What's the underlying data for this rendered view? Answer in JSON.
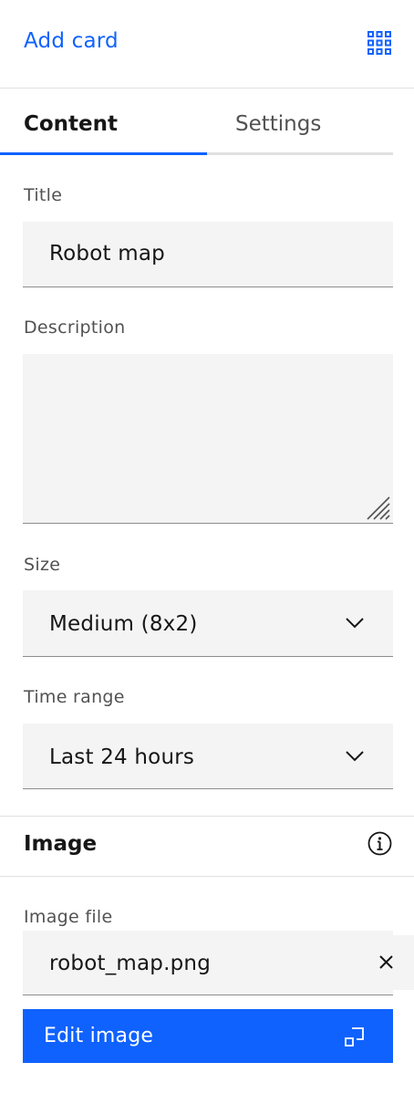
{
  "header": {
    "add_card_label": "Add card",
    "grid_icon": "app-grid-icon"
  },
  "tabs": [
    {
      "label": "Content",
      "selected": true
    },
    {
      "label": "Settings",
      "selected": false
    }
  ],
  "form": {
    "title": {
      "label": "Title",
      "value": "Robot map"
    },
    "description": {
      "label": "Description",
      "value": ""
    },
    "size": {
      "label": "Size",
      "value": "Medium (8x2)"
    },
    "time_range": {
      "label": "Time range",
      "value": "Last 24 hours"
    }
  },
  "image_section": {
    "title": "Image",
    "info_icon": "information-icon",
    "file_label": "Image file",
    "file_name": "robot_map.png",
    "clear_icon": "close-icon",
    "edit_button_label": "Edit image",
    "edit_icon": "launch-icon"
  },
  "colors": {
    "accent": "#0f62fe",
    "field_bg": "#f4f4f4",
    "text_primary": "#161616",
    "text_secondary": "#525252",
    "divider": "#e0e0e0"
  }
}
